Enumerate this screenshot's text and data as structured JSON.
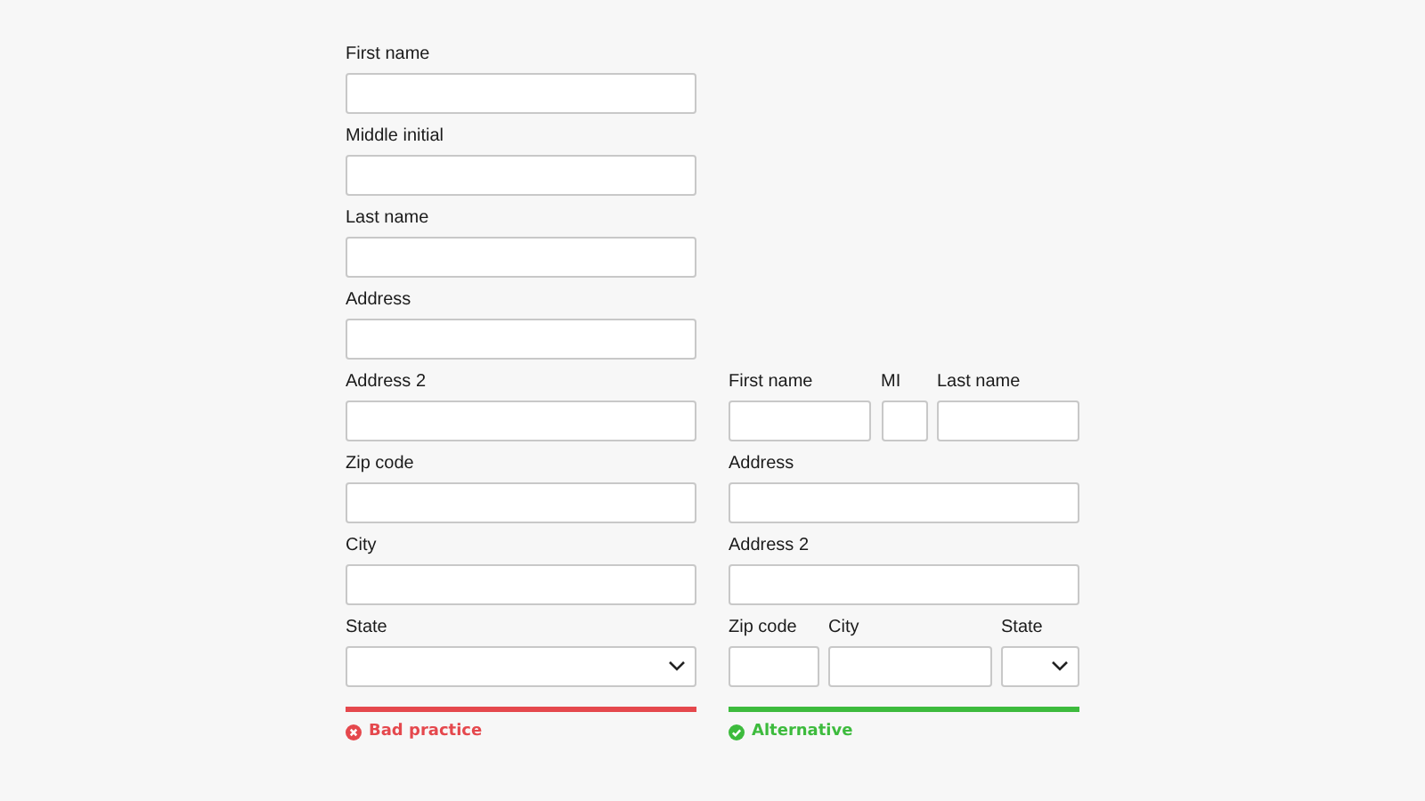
{
  "panels": [
    {
      "verdict": {
        "kind": "bad",
        "label": "Bad practice"
      },
      "rows": [
        [
          {
            "label": "First name",
            "kind": "text"
          }
        ],
        [
          {
            "label": "Middle initial",
            "kind": "text"
          }
        ],
        [
          {
            "label": "Last name",
            "kind": "text"
          }
        ],
        [
          {
            "label": "Address",
            "kind": "text"
          }
        ],
        [
          {
            "label": "Address 2",
            "kind": "text"
          }
        ],
        [
          {
            "label": "Zip code",
            "kind": "text"
          }
        ],
        [
          {
            "label": "City",
            "kind": "text"
          }
        ],
        [
          {
            "label": "State",
            "kind": "select"
          }
        ]
      ]
    },
    {
      "verdict": {
        "kind": "good",
        "label": "Alternative"
      },
      "rows": [
        [
          {
            "label": "First name",
            "kind": "text"
          },
          {
            "label": "MI",
            "kind": "text"
          },
          {
            "label": "Last name",
            "kind": "text"
          }
        ],
        [
          {
            "label": "Address",
            "kind": "text"
          }
        ],
        [
          {
            "label": "Address 2",
            "kind": "text"
          }
        ],
        [
          {
            "label": "Zip code",
            "kind": "text"
          },
          {
            "label": "City",
            "kind": "text"
          },
          {
            "label": "State",
            "kind": "select"
          }
        ]
      ]
    }
  ]
}
